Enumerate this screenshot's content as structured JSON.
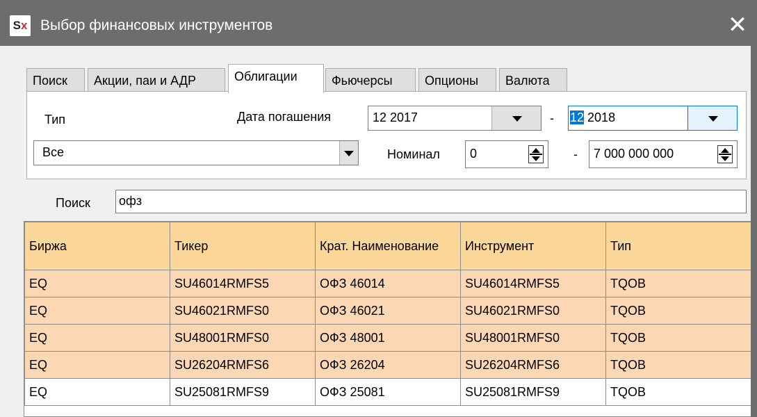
{
  "window": {
    "title": "Выбор финансовых инструментов",
    "icon_label_s": "S",
    "icon_label_x": "x",
    "close_glyph": "✕"
  },
  "tabs": [
    {
      "label": "Поиск",
      "active": false
    },
    {
      "label": "Акции, паи и АДР",
      "active": false
    },
    {
      "label": "Облигации",
      "active": true
    },
    {
      "label": "Фьючерсы",
      "active": false
    },
    {
      "label": "Опционы",
      "active": false
    },
    {
      "label": "Валюта",
      "active": false
    }
  ],
  "filters": {
    "type_label": "Тип",
    "type_value": "Все",
    "maturity_label": "Дата погашения",
    "maturity_from": "12 2017",
    "maturity_to_selected": "12",
    "maturity_to_rest": " 2018",
    "dash": "-",
    "nominal_label": "Номинал",
    "nominal_from": "0",
    "nominal_to": "7 000 000 000"
  },
  "search": {
    "label": "Поиск",
    "value": "офз"
  },
  "table": {
    "columns": [
      "Биржа",
      "Тикер",
      "Крат. Наименование",
      "Инструмент",
      "Тип"
    ],
    "rows": [
      [
        "EQ",
        "SU46014RMFS5",
        "ОФЗ 46014",
        "SU46014RMFS5",
        "TQOB"
      ],
      [
        "EQ",
        "SU46021RMFS0",
        "ОФЗ 46021",
        "SU46021RMFS0",
        "TQOB"
      ],
      [
        "EQ",
        "SU48001RMFS0",
        "ОФЗ 48001",
        "SU48001RMFS0",
        "TQOB"
      ],
      [
        "EQ",
        "SU26204RMFS6",
        "ОФЗ 26204",
        "SU26204RMFS6",
        "TQOB"
      ],
      [
        "EQ",
        "SU25081RMFS9",
        "ОФЗ 25081",
        "SU25081RMFS9",
        "TQOB"
      ]
    ]
  },
  "colors": {
    "titlebar": "#6d6d6d",
    "header_bg": "#fbd79a",
    "row_bg": "#fbd7b4",
    "selection": "#0078d7"
  }
}
